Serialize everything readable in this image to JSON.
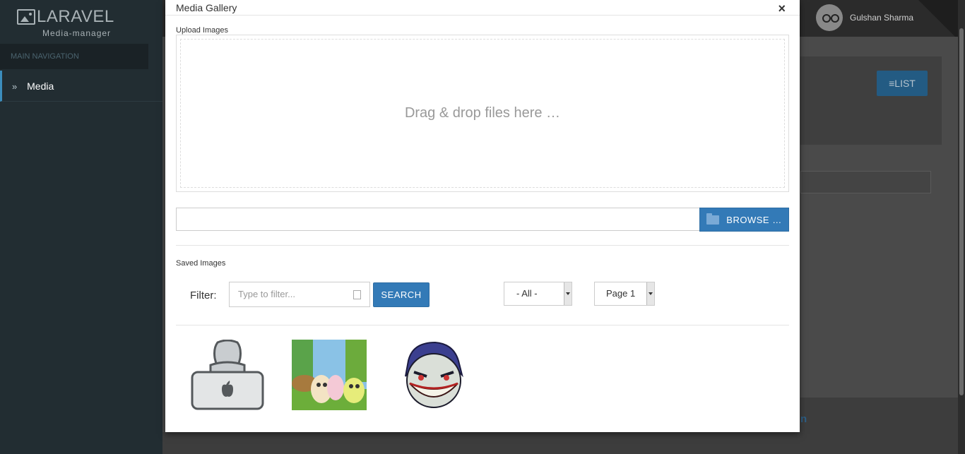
{
  "app": {
    "logo_text": "LARAVEL",
    "logo_sub": "Media-manager",
    "nav_header": "MAIN NAVIGATION",
    "nav_items": [
      {
        "label": "Media"
      }
    ],
    "user_name": "Gulshan Sharma",
    "list_button": "LIST"
  },
  "modal": {
    "title": "Media Gallery",
    "close": "×",
    "upload_label": "Upload Images",
    "dropzone_text": "Drag & drop files here …",
    "browse_label": "BROWSE …",
    "saved_label": "Saved Images",
    "filter_label": "Filter:",
    "filter_placeholder": "Type to filter...",
    "search_label": "SEARCH",
    "type_select": "- All -",
    "page_select": "Page 1",
    "images": [
      {
        "name": "apple-user-icon"
      },
      {
        "name": "angry-birds-chicks-image"
      },
      {
        "name": "joker-face-image"
      }
    ]
  },
  "colors": {
    "primary": "#337ab7",
    "sidebar": "#222d32",
    "active_border": "#3c8dbc"
  }
}
